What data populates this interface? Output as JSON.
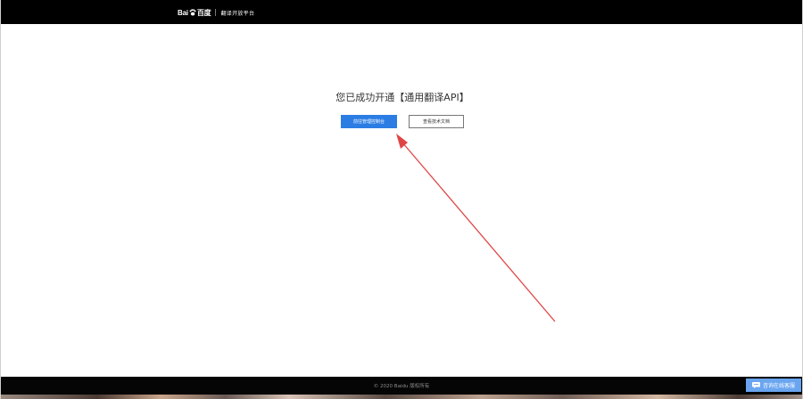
{
  "header": {
    "logo_left": "Bai",
    "logo_right": "百度",
    "platform_name": "翻译开放平台"
  },
  "main": {
    "success_message": "您已成功开通【通用翻译API】",
    "primary_button": "前往管理控制台",
    "secondary_button": "查看技术文档"
  },
  "footer": {
    "copyright": "© 2020 Baidu 版权所有",
    "chat_button": "咨询在线客服"
  },
  "colors": {
    "header_bg": "#000000",
    "primary": "#2b7de4",
    "annotation_arrow": "#e04545",
    "chat_button": "#6aa5f0"
  },
  "icons": [
    "baidu-paw-icon",
    "chat-bubble-icon",
    "annotation-arrow"
  ]
}
